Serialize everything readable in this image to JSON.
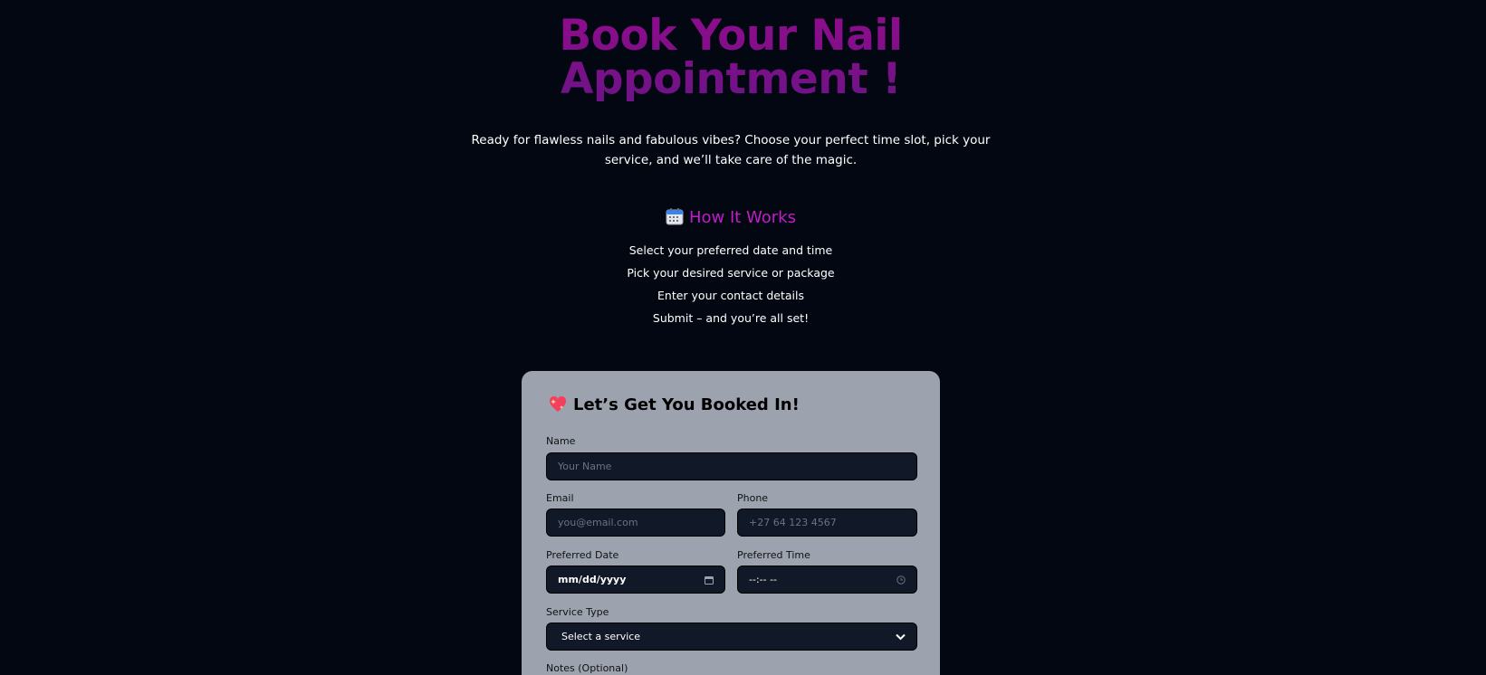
{
  "hero": {
    "title_line1": "Book Your Nail",
    "title_line2": "Appointment !",
    "subtitle_line1": "Ready for flawless nails and fabulous vibes? Choose your perfect time slot, pick your",
    "subtitle_line2": "service, and we’ll take care of the magic."
  },
  "how_it_works": {
    "icon": "calendar-icon",
    "heading": "How It Works",
    "steps": [
      "Select your preferred date and time",
      "Pick your desired service or package",
      "Enter your contact details",
      "Submit – and you’re all set!"
    ]
  },
  "form": {
    "icon": "sparkling-heart-icon",
    "title": "Let’s Get You Booked In!",
    "name_label": "Name",
    "name_placeholder": "Your Name",
    "email_label": "Email",
    "email_placeholder": "you@email.com",
    "phone_label": "Phone",
    "phone_placeholder": "+27 64 123 4567",
    "date_label": "Preferred Date",
    "date_value": "mm/dd/yyyy",
    "time_label": "Preferred Time",
    "time_value": "--:-- --",
    "service_label": "Service Type",
    "service_value": "Select a service",
    "notes_label": "Notes (Optional)"
  },
  "colors": {
    "background": "#030712",
    "title_gradient_top": "#8f0c8c",
    "title_gradient_bottom": "#6e1387",
    "heading_accent": "#c21cc8",
    "card_background": "#9ca3af",
    "field_background": "#111827"
  }
}
